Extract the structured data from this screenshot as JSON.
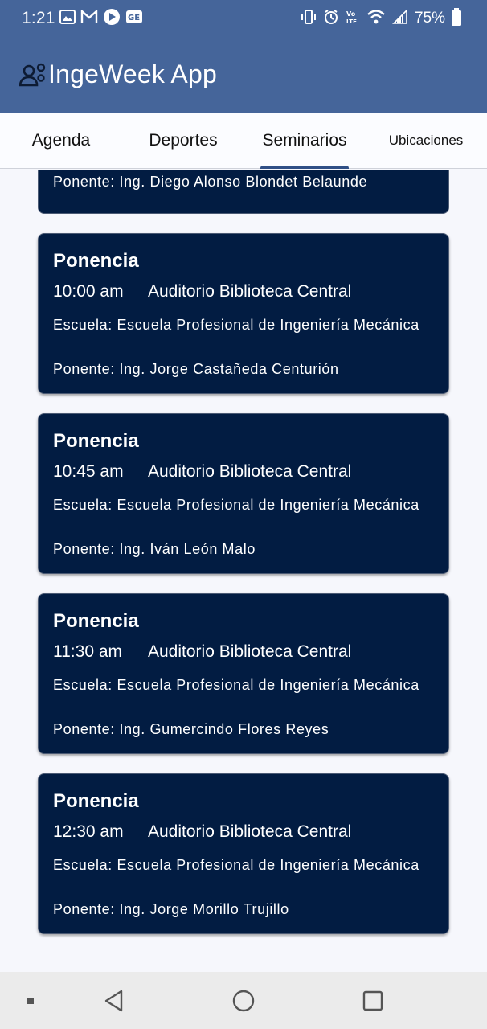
{
  "status_bar": {
    "time": "1:21",
    "battery_percent": "75%",
    "left_icons": [
      "gallery-icon",
      "gmail-icon",
      "media-icon",
      "news-icon"
    ],
    "right_icons": [
      "vibrate-icon",
      "alarm-icon",
      "volte-icon",
      "wifi-icon",
      "signal-icon",
      "battery-icon"
    ]
  },
  "app_bar": {
    "title": "IngeWeek App",
    "icon": "user-gear-icon"
  },
  "tabs": [
    {
      "label": "Agenda",
      "selected": false
    },
    {
      "label": "Deportes",
      "selected": false
    },
    {
      "label": "Seminarios",
      "selected": true
    },
    {
      "label": "Ubicaciones",
      "selected": false
    }
  ],
  "partial_card": {
    "speaker": "Ponente: Ing. Diego Alonso Blondet Belaunde"
  },
  "cards": [
    {
      "title": "Ponencia",
      "time": "10:00 am",
      "location": "Auditorio Biblioteca Central",
      "school": "Escuela: Escuela Profesional de Ingeniería Mecánica",
      "speaker": "Ponente: Ing. Jorge Castañeda Centurión"
    },
    {
      "title": "Ponencia",
      "time": "10:45 am",
      "location": "Auditorio Biblioteca Central",
      "school": "Escuela: Escuela Profesional de Ingeniería Mecánica",
      "speaker": "Ponente: Ing. Iván León Malo"
    },
    {
      "title": "Ponencia",
      "time": "11:30 am",
      "location": "Auditorio Biblioteca Central",
      "school": "Escuela: Escuela Profesional de Ingeniería Mecánica",
      "speaker": "Ponente: Ing. Gumercindo Flores Reyes"
    },
    {
      "title": "Ponencia",
      "time": "12:30 am",
      "location": "Auditorio Biblioteca Central",
      "school": "Escuela: Escuela Profesional de Ingeniería Mecánica",
      "speaker": "Ponente: Ing. Jorge Morillo Trujillo"
    }
  ],
  "nav_bar": {
    "buttons": [
      "menu-dot-icon",
      "back-icon",
      "home-icon",
      "recents-icon"
    ]
  },
  "colors": {
    "app_bar": "#45659a",
    "card_background": "#021c42",
    "tab_indicator": "#2f4f86",
    "page_background": "#f6f7fc"
  }
}
